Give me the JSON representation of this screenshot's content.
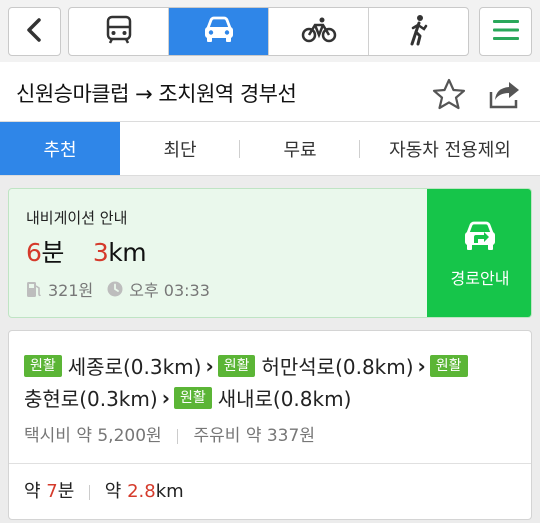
{
  "modes": [
    {
      "name": "bus",
      "icon": "bus-icon",
      "active": false
    },
    {
      "name": "car",
      "icon": "car-icon",
      "active": true
    },
    {
      "name": "bike",
      "icon": "bicycle-icon",
      "active": false
    },
    {
      "name": "walk",
      "icon": "walk-icon",
      "active": false
    }
  ],
  "header": {
    "route_title": "신원승마클럽 → 조치원역 경부선"
  },
  "tabs": [
    {
      "label": "추천",
      "active": true
    },
    {
      "label": "최단",
      "active": false
    },
    {
      "label": "무료",
      "active": false
    },
    {
      "label": "자동차 전용제외",
      "active": false
    }
  ],
  "navigation": {
    "label": "내비게이션 안내",
    "time_value": "6",
    "time_unit": "분",
    "distance_value": "3",
    "distance_unit": "km",
    "fuel_cost": "321원",
    "arrival_time": "오후 03:33",
    "guide_button": "경로안내"
  },
  "route_detail": {
    "badge": "원활",
    "roads": [
      "세종로(0.3km)",
      "허만석로(0.8km)",
      "충현로(0.3km)",
      "새내로(0.8km)"
    ],
    "taxi_fare": "택시비 약 5,200원",
    "fuel_fare": "주유비 약 337원",
    "summary_prefix_time": "약 ",
    "summary_time_value": "7",
    "summary_time_unit": "분",
    "summary_prefix_dist": "약 ",
    "summary_dist_value": "2.8",
    "summary_dist_unit": "km"
  },
  "colors": {
    "accent_blue": "#2f86e8",
    "guide_green": "#16c54a",
    "badge_green": "#5bb536",
    "highlight_red": "#d53a2b",
    "menu_green": "#2aa85a"
  }
}
